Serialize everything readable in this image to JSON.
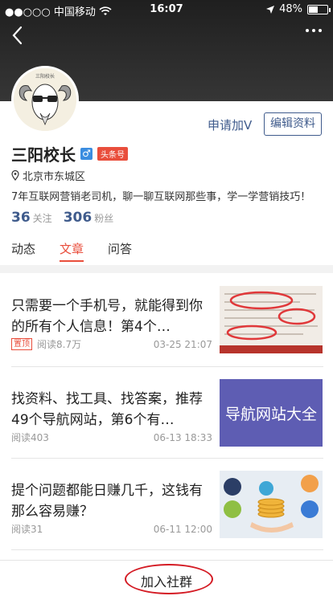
{
  "status_bar": {
    "carrier": "●●○○○ 中国移动",
    "time": "16:07",
    "battery": "48%",
    "battery_level": 0.48
  },
  "profile": {
    "avatar_label": "三阳校长",
    "apply_v": "申请加V",
    "edit_label": "编辑资料",
    "name": "三阳校长",
    "gender_symbol": "♂",
    "badge": "头条号",
    "location": "北京市东城区",
    "bio": "7年互联网营销老司机，聊一聊互联网那些事，学一学营销技巧！",
    "follow_count": "36",
    "follow_label": "关注",
    "fans_count": "306",
    "fans_label": "粉丝"
  },
  "tabs": [
    {
      "label": "动态",
      "active": false
    },
    {
      "label": "文章",
      "active": true
    },
    {
      "label": "问答",
      "active": false
    }
  ],
  "articles": [
    {
      "title": "只需要一个手机号，就能得到你的所有个人信息！第4个…",
      "pin": "置顶",
      "reads": "阅读8.7万",
      "date": "03-25 21:07"
    },
    {
      "title": "找资料、找工具、找答案，推荐49个导航网站，第6个有…",
      "pin": "",
      "reads": "阅读403",
      "date": "06-13 18:33",
      "thumb_text": "导航网站大全"
    },
    {
      "title": "提个问题都能日赚几千，这钱有那么容易赚？",
      "pin": "",
      "reads": "阅读31",
      "date": "06-11 12:00"
    }
  ],
  "bottom": {
    "join_label": "加入社群"
  },
  "colors": {
    "accent": "#e94e3c",
    "link": "#3f5b8c",
    "highlight_ring": "#d41b24"
  }
}
